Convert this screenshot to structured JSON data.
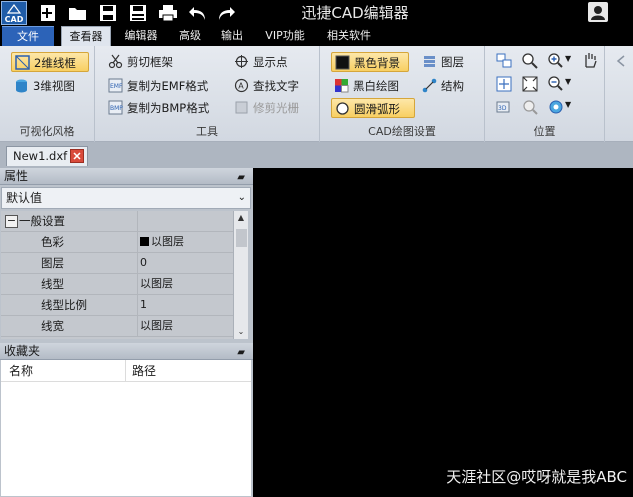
{
  "app": {
    "logo_text": "CAD",
    "title": "迅捷CAD编辑器"
  },
  "quick_access": [
    "new-icon",
    "open-icon",
    "save-icon",
    "save-as-icon",
    "print-icon",
    "undo-icon",
    "redo-icon"
  ],
  "menu_tabs": [
    "文件",
    "查看器",
    "编辑器",
    "高级",
    "输出",
    "VIP功能",
    "相关软件"
  ],
  "active_tab": "查看器",
  "ribbon": {
    "visual_style": {
      "label": "可视化风格",
      "wireframe_2d": "2维线框",
      "view_3d": "3维视图"
    },
    "tools": {
      "label": "工具",
      "clip_frame": "剪切框架",
      "copy_emf": "复制为EMF格式",
      "copy_bmp": "复制为BMP格式",
      "show_points": "显示点",
      "find_text": "查找文字",
      "trim_raster": "修剪光栅"
    },
    "cad_settings": {
      "label": "CAD绘图设置",
      "black_bg": "黑色背景",
      "bw_drawing": "黑白绘图",
      "smooth_arc": "圆滑弧形",
      "layers": "图层",
      "structure": "结构"
    },
    "position": {
      "label": "位置"
    }
  },
  "document": {
    "tab": "New1.dxf"
  },
  "properties": {
    "header": "属性",
    "selector": "默认值",
    "category": "一般设置",
    "rows": [
      {
        "name": "色彩",
        "value": "以图层"
      },
      {
        "name": "图层",
        "value": "0"
      },
      {
        "name": "线型",
        "value": "以图层"
      },
      {
        "name": "线型比例",
        "value": "1"
      },
      {
        "name": "线宽",
        "value": "以图层"
      }
    ]
  },
  "favorites": {
    "header": "收藏夹",
    "col_name": "名称",
    "col_path": "路径"
  },
  "watermark": "天涯社区@哎呀就是我ABC",
  "colors": {
    "ribbon_bg": "#dde2e9",
    "active_toggle": "#f8cf62",
    "file_tab": "#2c63b8",
    "canvas": "#000000"
  }
}
